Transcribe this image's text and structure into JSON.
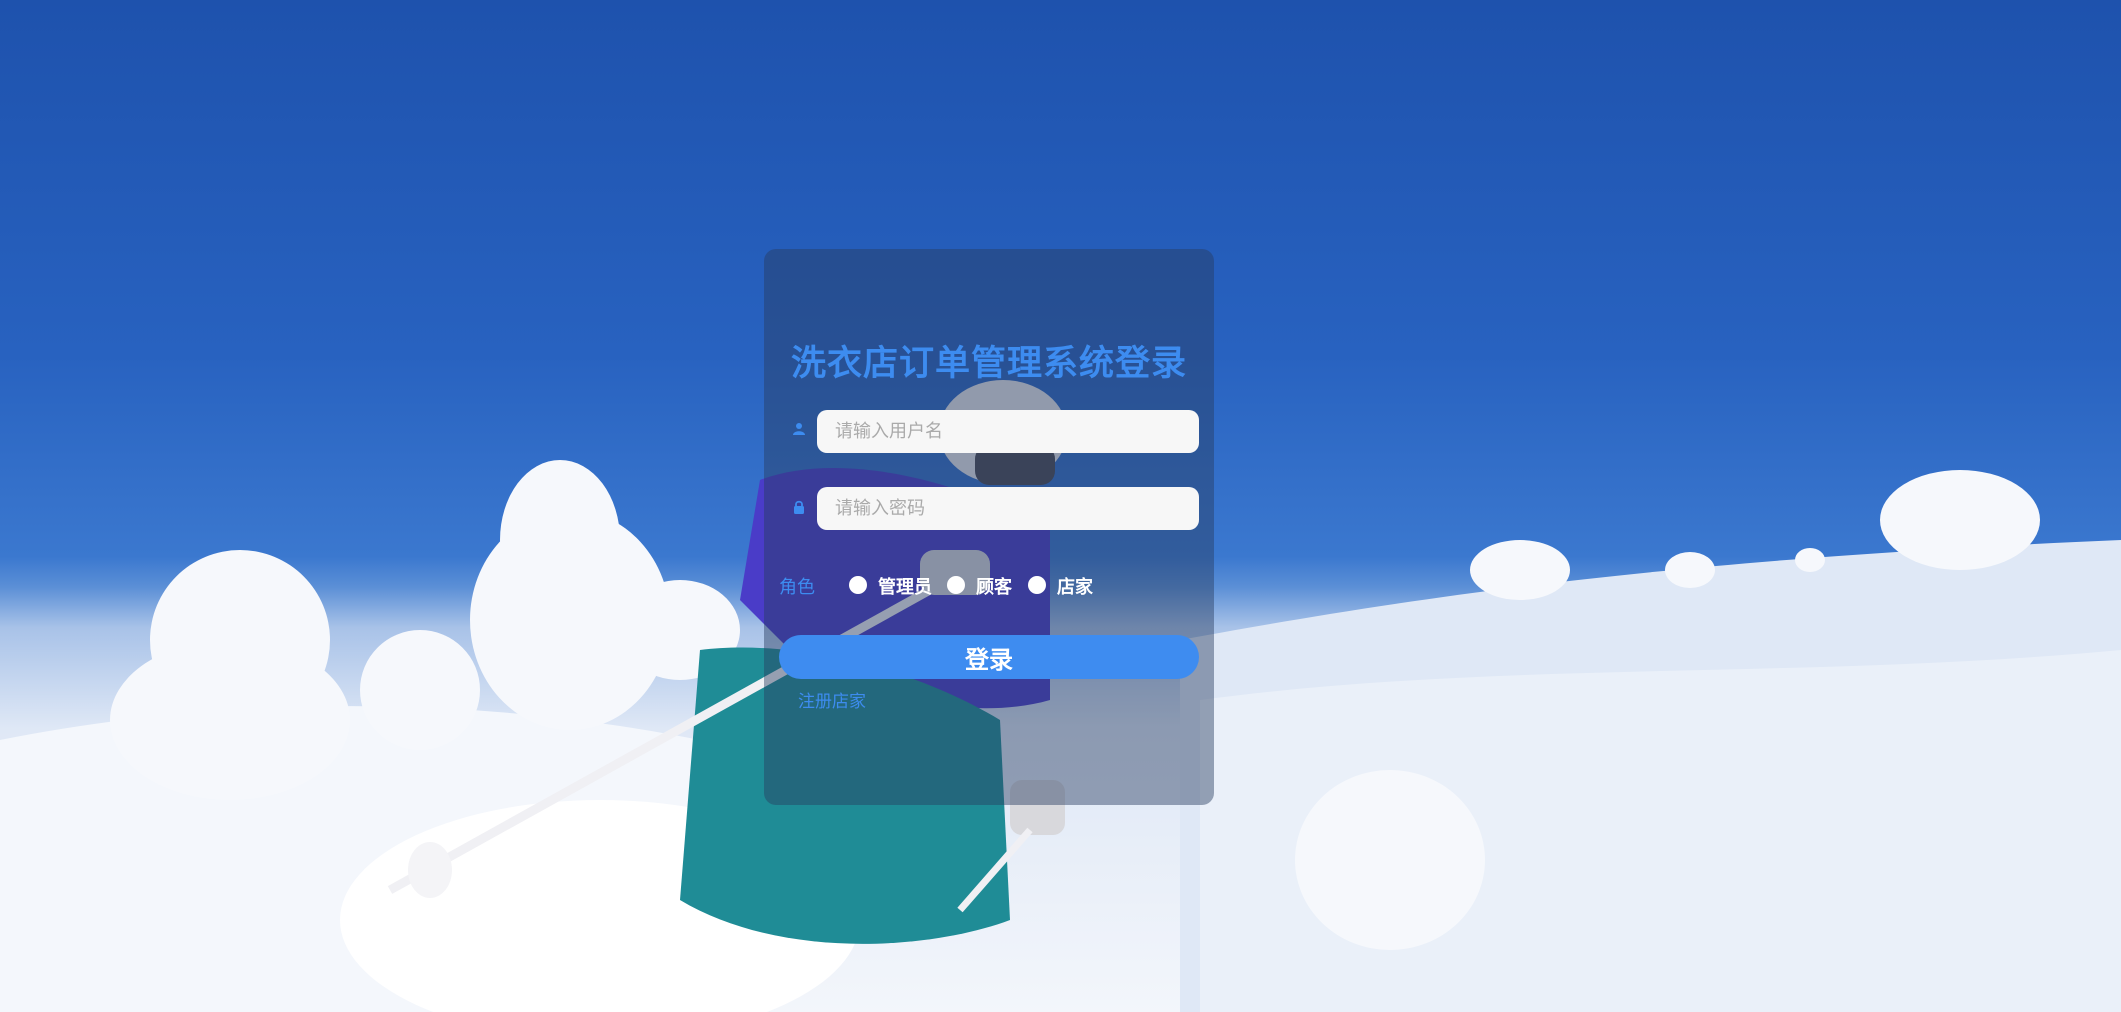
{
  "login": {
    "title": "洗衣店订单管理系统登录",
    "username_placeholder": "请输入用户名",
    "username_value": "",
    "password_placeholder": "请输入密码",
    "password_value": "",
    "role_label": "角色",
    "roles": [
      "管理员",
      "顾客",
      "店家"
    ],
    "login_button": "登录",
    "register_link": "注册店家"
  },
  "icons": {
    "username": "user-icon",
    "password": "lock-icon"
  },
  "colors": {
    "accent": "#3e8cf0",
    "panel": "rgba(40, 60, 95, 0.45)"
  }
}
